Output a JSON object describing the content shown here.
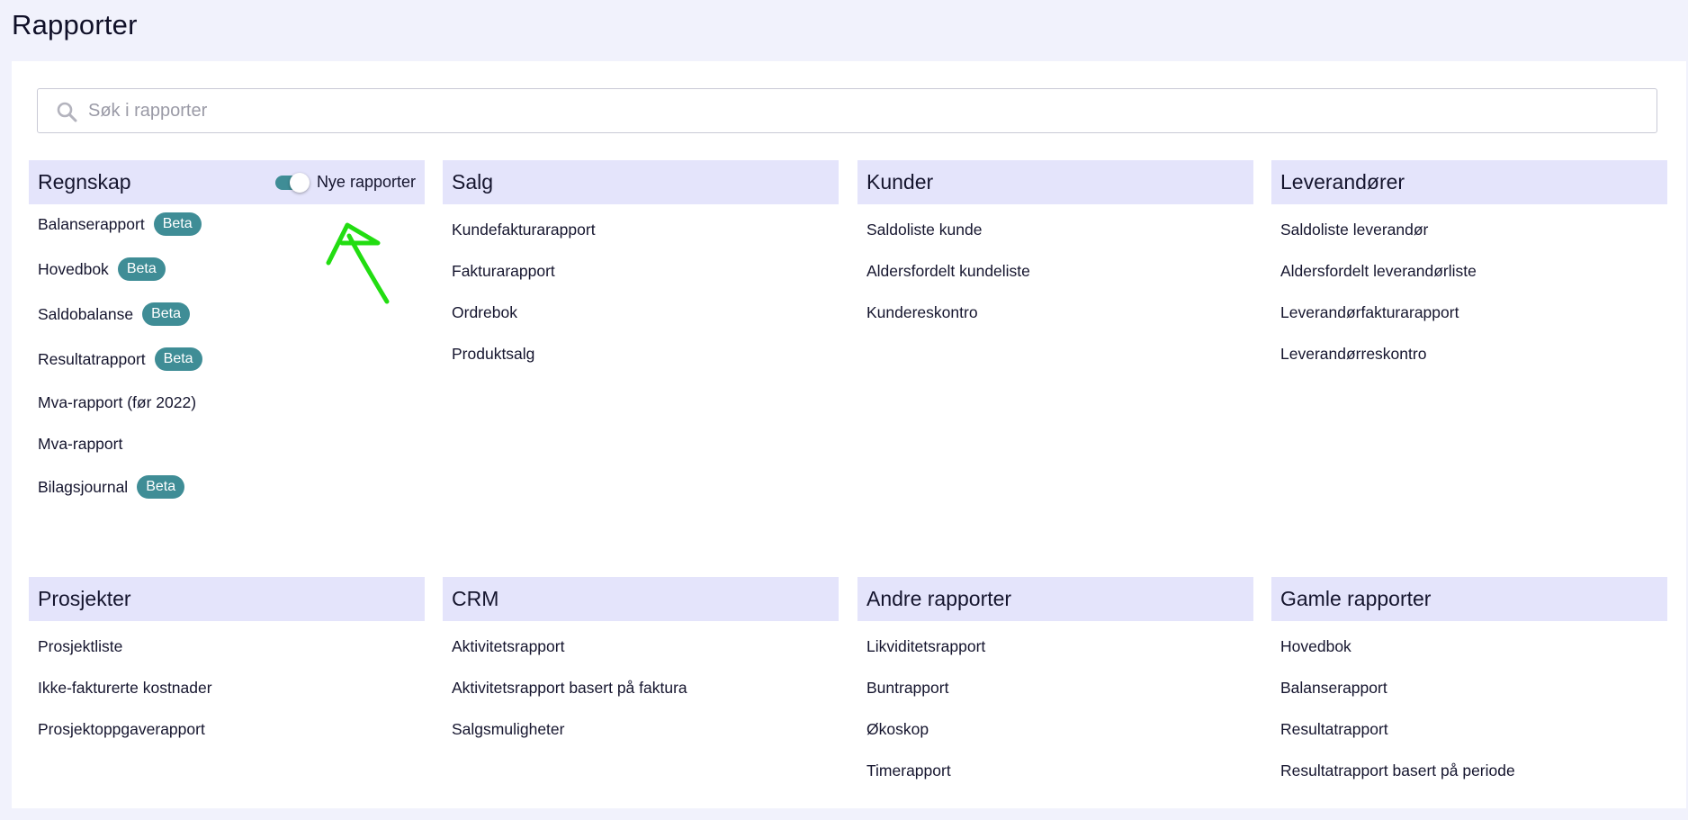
{
  "page": {
    "title": "Rapporter"
  },
  "search": {
    "placeholder": "Søk i rapporter"
  },
  "colors": {
    "accent": "#3f8d96",
    "header_bg": "#e4e4fb",
    "annotation": "#22dd11"
  },
  "regnskap": {
    "title": "Regnskap",
    "toggle_label": "Nye rapporter",
    "toggle_on": true,
    "items": [
      {
        "label": "Balanserapport",
        "badge": "Beta"
      },
      {
        "label": "Hovedbok",
        "badge": "Beta"
      },
      {
        "label": "Saldobalanse",
        "badge": "Beta"
      },
      {
        "label": "Resultatrapport",
        "badge": "Beta"
      },
      {
        "label": "Mva-rapport (før 2022)",
        "badge": ""
      },
      {
        "label": "Mva-rapport",
        "badge": ""
      },
      {
        "label": "Bilagsjournal",
        "badge": "Beta"
      }
    ]
  },
  "salg": {
    "title": "Salg",
    "items": [
      "Kundefakturarapport",
      "Fakturarapport",
      "Ordrebok",
      "Produktsalg"
    ]
  },
  "kunder": {
    "title": "Kunder",
    "items": [
      "Saldoliste kunde",
      "Aldersfordelt kundeliste",
      "Kundereskontro"
    ]
  },
  "leverandorer": {
    "title": "Leverandører",
    "items": [
      "Saldoliste leverandør",
      "Aldersfordelt leverandørliste",
      "Leverandørfakturarapport",
      "Leverandørreskontro"
    ]
  },
  "prosjekter": {
    "title": "Prosjekter",
    "items": [
      "Prosjektliste",
      "Ikke-fakturerte kostnader",
      "Prosjektoppgaverapport"
    ]
  },
  "crm": {
    "title": "CRM",
    "items": [
      "Aktivitetsrapport",
      "Aktivitetsrapport basert på faktura",
      "Salgsmuligheter"
    ]
  },
  "andre": {
    "title": "Andre rapporter",
    "items": [
      "Likviditetsrapport",
      "Buntrapport",
      "Økoskop",
      "Timerapport"
    ]
  },
  "gamle": {
    "title": "Gamle rapporter",
    "items": [
      "Hovedbok",
      "Balanserapport",
      "Resultatrapport",
      "Resultatrapport basert på periode"
    ]
  }
}
